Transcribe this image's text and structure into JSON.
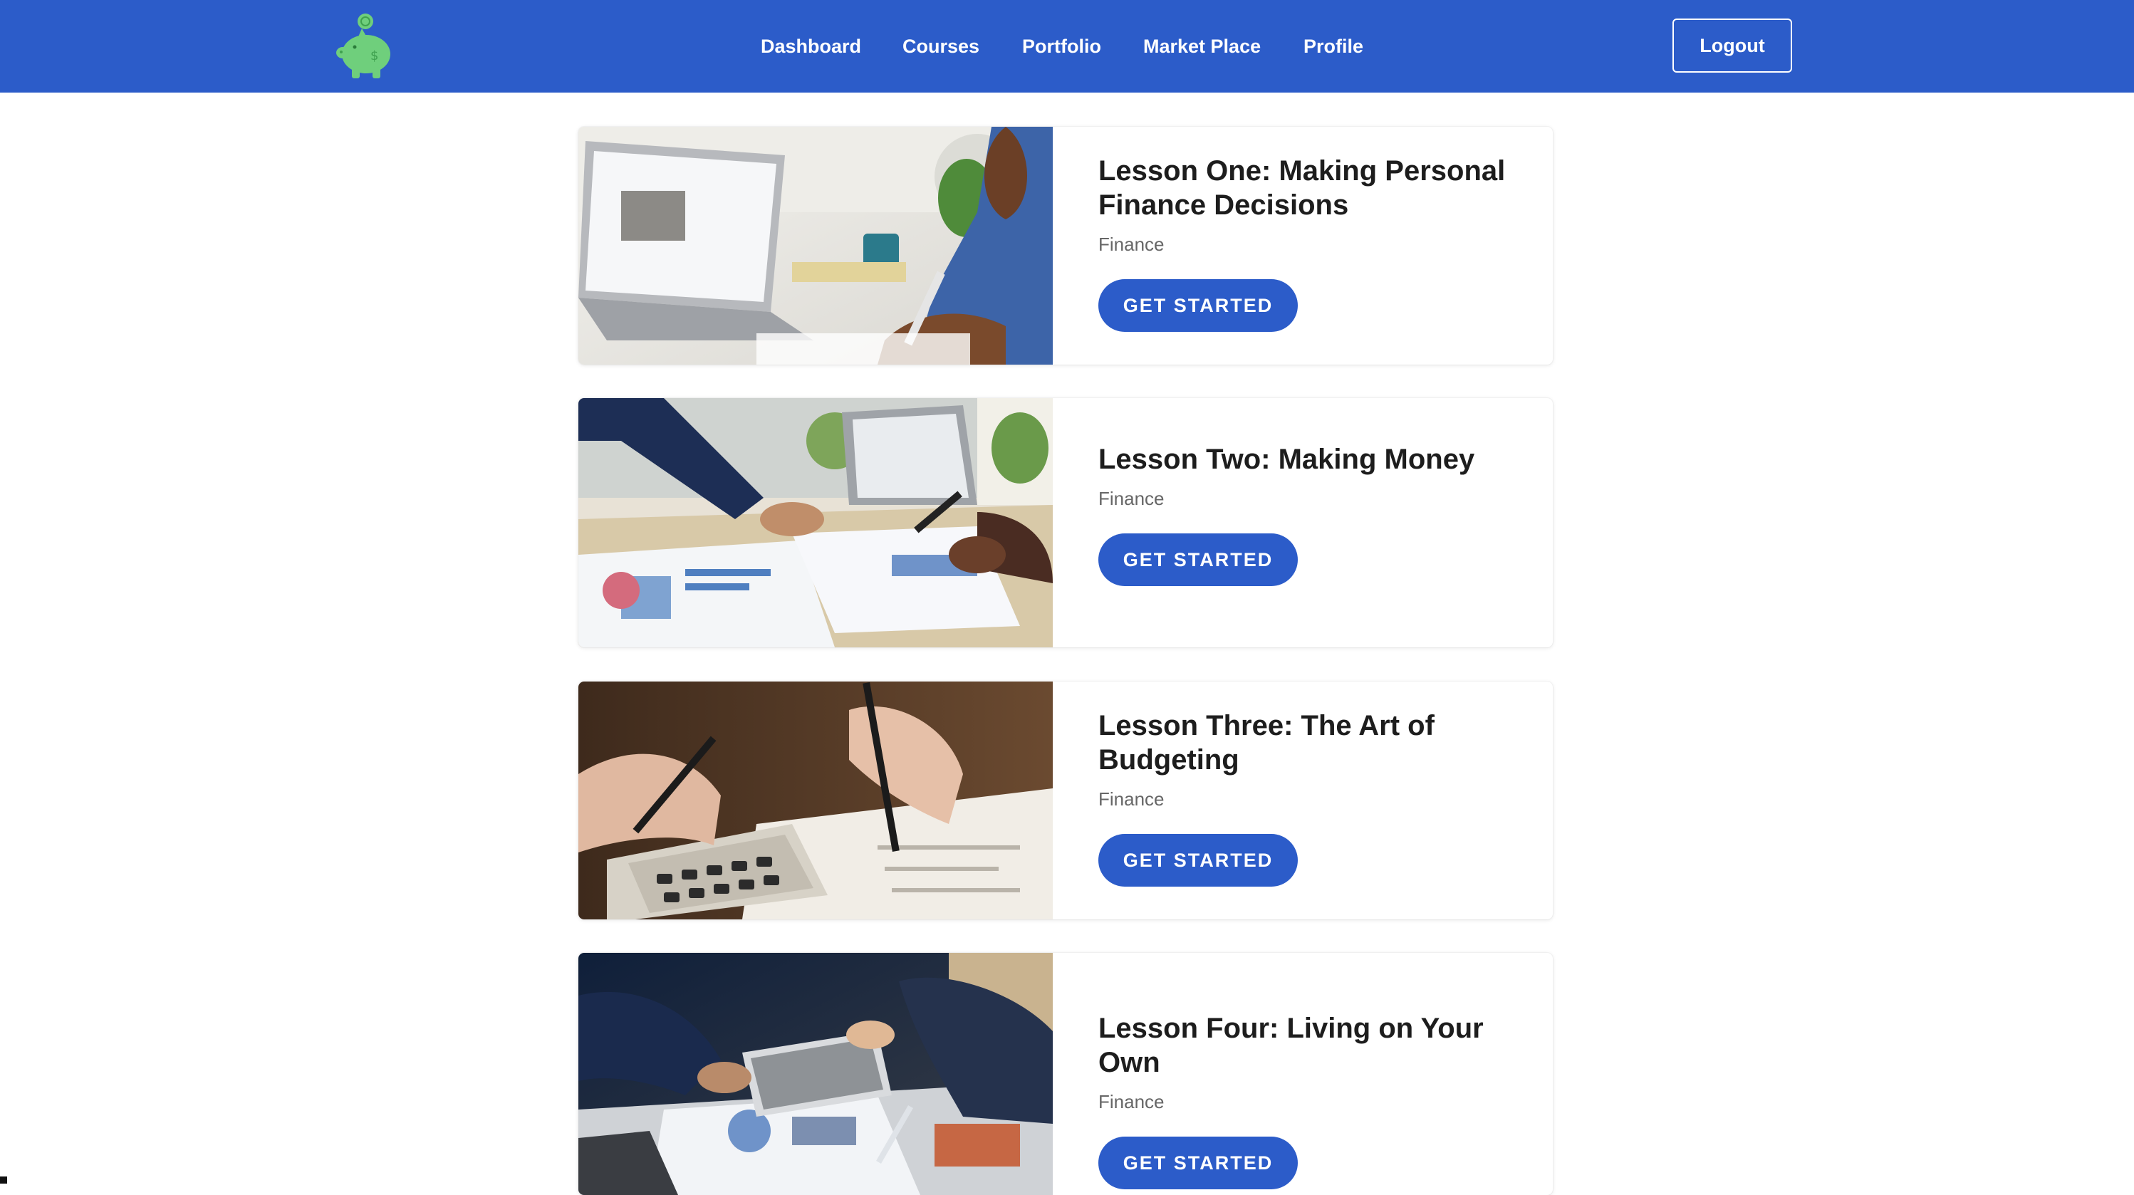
{
  "app": {
    "logo_icon": "piggy-bank-icon",
    "brand_color": "#2c5cc9",
    "logo_color": "#6fcf7c"
  },
  "nav": {
    "items": [
      {
        "label": "Dashboard"
      },
      {
        "label": "Courses"
      },
      {
        "label": "Portfolio"
      },
      {
        "label": "Market Place"
      },
      {
        "label": "Profile"
      }
    ],
    "logout_label": "Logout"
  },
  "lessons": [
    {
      "title": "Lesson One: Making Personal Finance Decisions",
      "category": "Finance",
      "button_label": "GET STARTED",
      "image": "laptop-man-writing-photo"
    },
    {
      "title": "Lesson Two: Making Money",
      "category": "Finance",
      "button_label": "GET STARTED",
      "image": "charts-meeting-photo"
    },
    {
      "title": "Lesson Three: The Art of Budgeting",
      "category": "Finance",
      "button_label": "GET STARTED",
      "image": "calculator-hands-photo"
    },
    {
      "title": "Lesson Four: Living on Your Own",
      "category": "Finance",
      "button_label": "GET STARTED",
      "image": "tablet-business-photo"
    }
  ]
}
